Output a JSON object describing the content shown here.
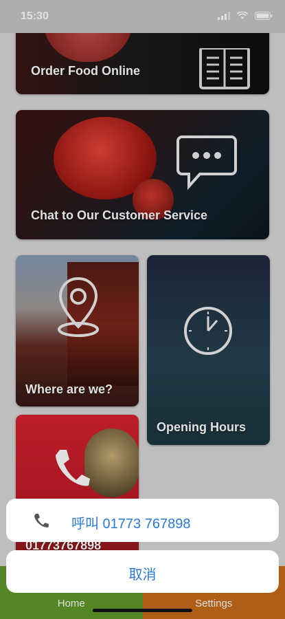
{
  "status_bar": {
    "time": "15:30"
  },
  "tiles": {
    "order_food": {
      "label": "Order Food Online",
      "icon": "menu-book-icon"
    },
    "chat": {
      "label": "Chat to Our Customer Service",
      "icon": "chat-bubble-icon"
    },
    "location": {
      "label": "Where are we?",
      "icon": "map-pin-icon"
    },
    "hours": {
      "label": "Opening Hours",
      "icon": "clock-icon"
    },
    "phone": {
      "label": "01773767898",
      "icon": "phone-icon"
    }
  },
  "action_sheet": {
    "call_label": "呼叫 01773 767898",
    "call_icon": "phone-icon",
    "cancel_label": "取消"
  },
  "tab_bar": {
    "home_label": "Home",
    "settings_label": "Settings",
    "home_color": "#5f9a2a",
    "settings_color": "#c76b1a"
  }
}
